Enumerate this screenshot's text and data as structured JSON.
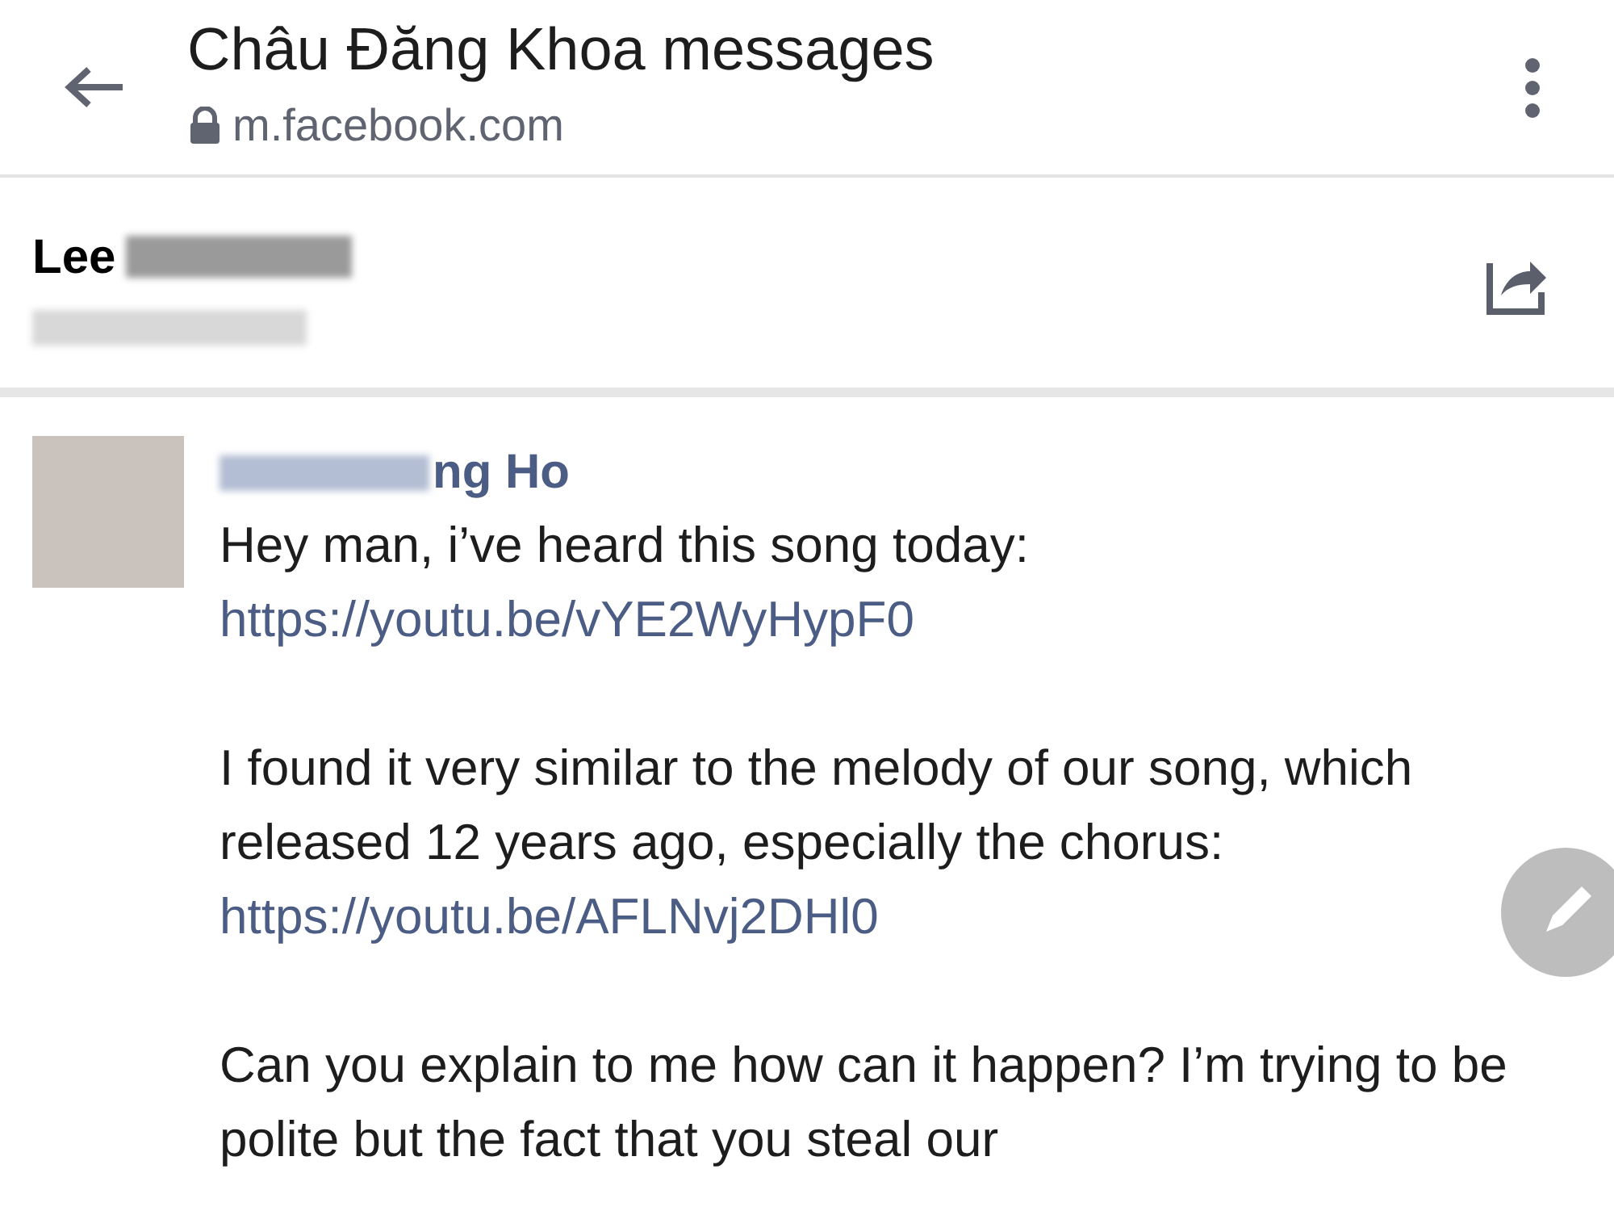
{
  "header": {
    "title": "Châu Đăng Khoa messages",
    "url": "m.facebook.com"
  },
  "profile": {
    "name_visible": "Lee"
  },
  "message": {
    "sender_visible": "ng Ho",
    "paragraphs": [
      [
        {
          "kind": "text",
          "text": "Hey man, i’ve heard this song today: "
        },
        {
          "kind": "link",
          "text": "https://"
        },
        {
          "kind": "link",
          "text": "youtu.be/vYE2WyHypF0"
        }
      ],
      [
        {
          "kind": "text",
          "text": "I found it very similar to the melody of our song, which released 12 years ago, especially the chorus: "
        },
        {
          "kind": "link",
          "text": "https://youtu.be/AFLNvj2DHl0"
        }
      ],
      [
        {
          "kind": "text",
          "text": "Can you explain to me how can it happen? I’m trying to be polite but the fact that you steal our"
        }
      ]
    ]
  }
}
